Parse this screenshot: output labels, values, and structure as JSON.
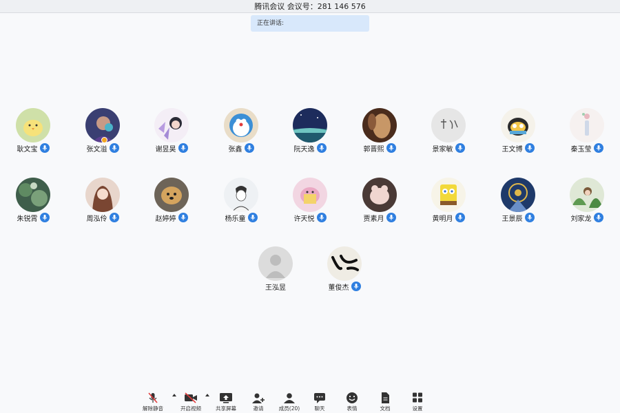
{
  "window": {
    "title": "腾讯会议 会议号：281 146 576"
  },
  "speaking": {
    "label": "正在讲话:"
  },
  "participants": [
    {
      "name": "耿文宝",
      "avatar": "chick-icon"
    },
    {
      "name": "张文溢",
      "avatar": "portrait-icon",
      "host": true
    },
    {
      "name": "谢昱昊",
      "avatar": "anime-girl-icon"
    },
    {
      "name": "张鑫",
      "avatar": "doraemon-icon"
    },
    {
      "name": "阮天逸",
      "avatar": "night-sky-icon"
    },
    {
      "name": "郭晋熙",
      "avatar": "blur-photo-icon"
    },
    {
      "name": "景家敏",
      "avatar": "calligraphy-icon"
    },
    {
      "name": "王文博",
      "avatar": "cartoon-bird-icon"
    },
    {
      "name": "秦玉莹",
      "avatar": "bottle-icon"
    },
    {
      "name": "朱锐霄",
      "avatar": "forest-icon"
    },
    {
      "name": "周泓伶",
      "avatar": "anime-girl-icon"
    },
    {
      "name": "赵婷婷",
      "avatar": "dog-icon"
    },
    {
      "name": "杨乐童",
      "avatar": "sketch-man-icon"
    },
    {
      "name": "许天悦",
      "avatar": "pink-cartoon-icon"
    },
    {
      "name": "贾素月",
      "avatar": "plush-icon"
    },
    {
      "name": "黄明月",
      "avatar": "spongebob-icon"
    },
    {
      "name": "王景辰",
      "avatar": "tarot-icon"
    },
    {
      "name": "刘家龙",
      "avatar": "jungle-icon"
    },
    {
      "name": "王泓昱",
      "avatar": "default-user-icon",
      "no_mic": true
    },
    {
      "name": "董俊杰",
      "avatar": "brush-stroke-icon"
    }
  ],
  "toolbar": {
    "unmute": "解除静音",
    "start_video": "开启视频",
    "share_screen": "共享屏幕",
    "invite": "邀请",
    "members": "成员(20)",
    "chat": "聊天",
    "reactions": "表情",
    "docs": "文档",
    "settings": "设置"
  },
  "colors": {
    "accent": "#2f7fe0",
    "speaking_bg": "#d8e8fb",
    "host_badge": "#f2a623"
  }
}
